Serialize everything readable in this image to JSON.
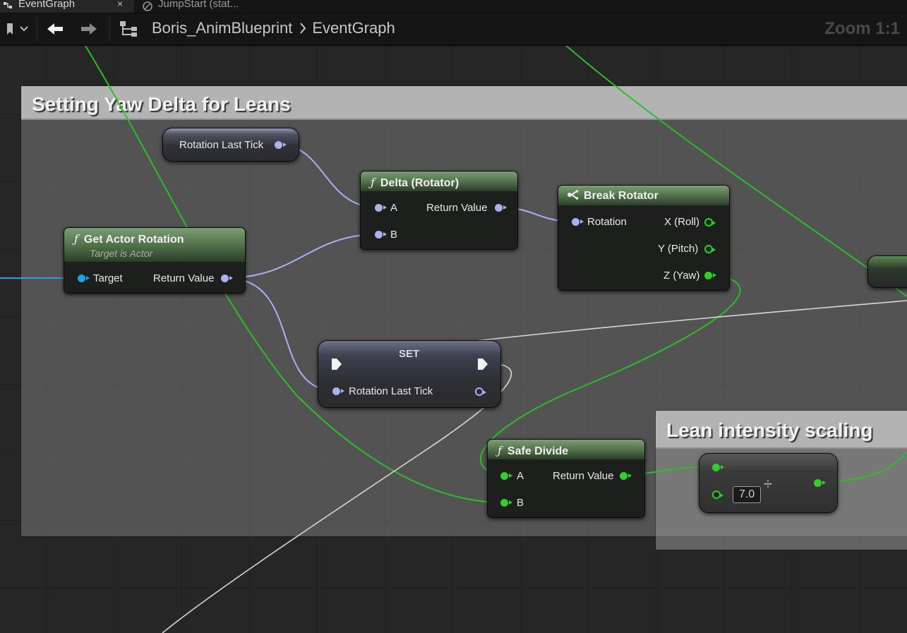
{
  "tabs": [
    {
      "label": "EventGraph",
      "close": "×"
    },
    {
      "label": "JumpStart (stat..."
    }
  ],
  "toolbar": {
    "breadcrumb": [
      "Boris_AnimBlueprint",
      "EventGraph"
    ],
    "zoom": "Zoom 1:1"
  },
  "comments": [
    {
      "title": "Setting Yaw Delta for Leans"
    },
    {
      "title": "Lean intensity scaling"
    }
  ],
  "nodes": {
    "rotation_last_tick_getter": {
      "label": "Rotation Last Tick"
    },
    "delta_rotator": {
      "title": "Delta (Rotator)",
      "glyph": "ƒ",
      "pins": {
        "a": "A",
        "b": "B",
        "out": "Return Value"
      }
    },
    "break_rotator": {
      "title": "Break Rotator",
      "pins": {
        "in": "Rotation",
        "x": "X (Roll)",
        "y": "Y (Pitch)",
        "z": "Z (Yaw)"
      }
    },
    "get_actor_rotation": {
      "title": "Get Actor Rotation",
      "glyph": "ƒ",
      "subtitle": "Target is Actor",
      "pins": {
        "target": "Target",
        "out": "Return Value"
      }
    },
    "set_node": {
      "title": "SET",
      "pins": {
        "in": "Rotation Last Tick"
      }
    },
    "safe_divide": {
      "title": "Safe Divide",
      "glyph": "ƒ",
      "pins": {
        "a": "A",
        "b": "B",
        "out": "Return Value"
      }
    },
    "divide": {
      "symbol": "÷",
      "value": "7.0"
    }
  },
  "colors": {
    "rotator_pin": "#a6b2f4",
    "object_pin": "#19a4e4",
    "float_pin": "#2fd02a",
    "pure_function_header": "#4e6d48"
  }
}
